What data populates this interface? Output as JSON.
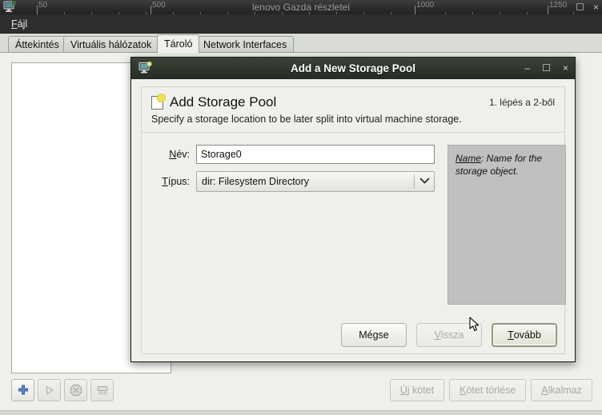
{
  "window": {
    "title": "lenovo Gazda részletei",
    "app_icon": "computer-icon",
    "minimize_label": "–",
    "maximize_label": "☐",
    "close_label": "×",
    "ruler_labels": [
      "50",
      "500",
      "1000",
      "1250"
    ]
  },
  "menubar": {
    "items": [
      {
        "label_mnemonic": "F",
        "label_rest": "ájl"
      }
    ]
  },
  "tabs": [
    {
      "label": "Áttekintés",
      "active": false
    },
    {
      "label": "Virtuális hálózatok",
      "active": false
    },
    {
      "label": "Tároló",
      "active": true
    },
    {
      "label": "Network Interfaces",
      "active": false
    }
  ],
  "storage_panel": {
    "list_items": [],
    "toolbar": [
      {
        "icon": "plus-icon",
        "enabled": true
      },
      {
        "icon": "play-icon",
        "enabled": false
      },
      {
        "icon": "stop-icon",
        "enabled": false
      },
      {
        "icon": "shredder-icon",
        "enabled": false
      }
    ],
    "actions": [
      {
        "label_mnemonic": "Ú",
        "label_rest": "j kötet",
        "enabled": false
      },
      {
        "label_mnemonic": "K",
        "label_rest": "ötet törlése",
        "enabled": false
      },
      {
        "label_mnemonic": "A",
        "label_rest": "lkalmaz",
        "enabled": false
      }
    ]
  },
  "dialog": {
    "titlebar_title": "Add a New Storage Pool",
    "titlebar_icon": "computer-add-icon",
    "minimize_label": "–",
    "maximize_label": "☐",
    "close_label": "×",
    "heading": "Add Storage Pool",
    "heading_icon": "new-document-icon",
    "step_text": "1. lépés a 2-ből",
    "subtitle": "Specify a storage location to be later split into virtual machine storage.",
    "fields": {
      "name": {
        "label_mnemonic": "N",
        "label_rest": "év:",
        "value": "Storage0",
        "placeholder": ""
      },
      "type": {
        "label_mnemonic": "T",
        "label_rest": "ípus:",
        "selected": "dir: Filesystem Directory",
        "arrow_icon": "chevron-down-icon"
      }
    },
    "help": {
      "key": "Name",
      "text": ": Name for the storage object."
    },
    "buttons": [
      {
        "id": "cancel",
        "label_mnemonic": "",
        "label_rest": "Mégse",
        "enabled": true,
        "default": false
      },
      {
        "id": "back",
        "label_mnemonic": "V",
        "label_rest": "issza",
        "enabled": false,
        "default": false
      },
      {
        "id": "forward",
        "label_mnemonic": "T",
        "label_rest": "ovább",
        "enabled": true,
        "default": true
      }
    ]
  },
  "colors": {
    "window_bg": "#d3d7cf",
    "content_bg": "#eff0ec",
    "dialog_title_bg": "#333b30",
    "help_panel_bg": "#c0c0c0",
    "accent_focus": "#8d9b74",
    "plus_icon": "#3465a4"
  }
}
